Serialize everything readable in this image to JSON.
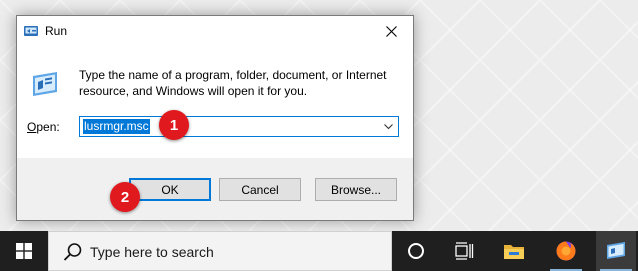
{
  "dialog": {
    "title": "Run",
    "description": "Type the name of a program, folder, document, or Internet resource, and Windows will open it for you.",
    "open_label_accel": "O",
    "open_label_rest": "pen:",
    "input_value": "lusrmgr.msc",
    "ok_label": "OK",
    "cancel_label": "Cancel",
    "browse_label": "Browse..."
  },
  "callouts": {
    "step1": "1",
    "step2": "2"
  },
  "taskbar": {
    "search_placeholder": "Type here to search"
  },
  "colors": {
    "accent": "#0078d7",
    "callout": "#e0191e",
    "taskbar": "#1f1f1f"
  }
}
